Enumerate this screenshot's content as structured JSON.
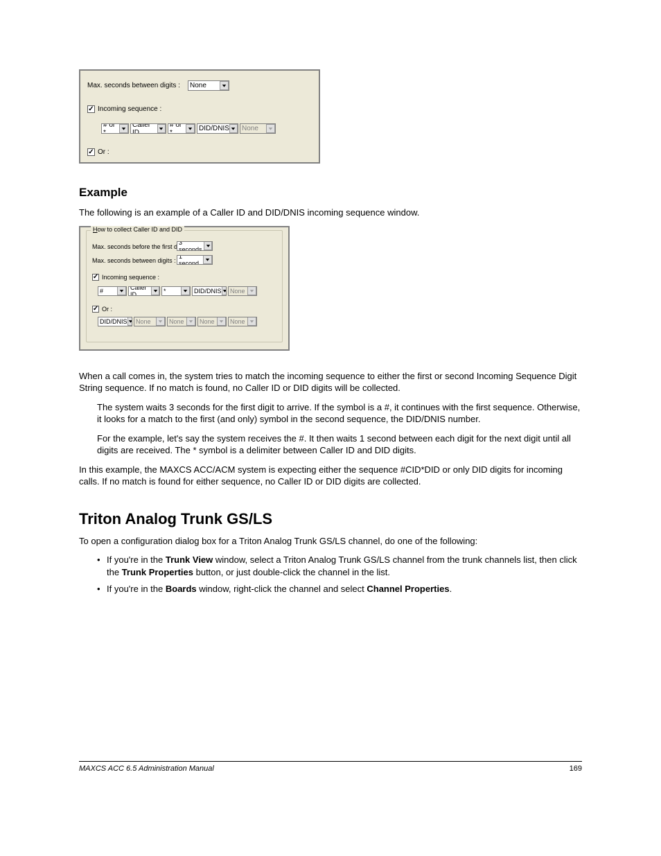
{
  "shot1": {
    "max_between_label": "Max. seconds between digits :",
    "max_between_value": "None",
    "incoming_label": "Incoming sequence :",
    "c1": "# or *",
    "c2": "Caller ID",
    "c3": "# or *",
    "c4": "DID/DNIS",
    "c5": "None",
    "or_label": "Or :"
  },
  "shot2": {
    "legend_pre": "H",
    "legend_rest": "ow to collect Caller ID and DID",
    "max_before_label": "Max. seconds before the first digit :",
    "max_before_value": "3 seconds",
    "max_between_label": "Max. seconds between digits :",
    "max_between_value": "1 second",
    "incoming_label": "Incoming sequence :",
    "r4c1": "#",
    "r4c2": "Caller ID",
    "r4c3": "*",
    "r4c4": "DID/DNIS",
    "r4c5": "None",
    "or_label": "Or :",
    "r6c1": "DID/DNIS",
    "r6c2": "None",
    "r6c3": "None",
    "r6c4": "None",
    "r6c5": "None"
  },
  "doc": {
    "sec_example": "Example",
    "p_intro": "The following is an example of a Caller ID and DID/DNIS incoming sequence window.",
    "p_when": "When a call comes in, the system tries to match the incoming sequence to either the first or second Incoming Sequence Digit String sequence. If no match is found, no Caller ID or DID digits will be collected.",
    "p_wait": "The system waits 3 seconds for the first digit to arrive. If the symbol is a #, it continues with the first sequence. Otherwise, it looks for a match to the first (and only) symbol in the second sequence, the DID/DNIS number.",
    "p_for": "For the example, let's say the system receives the #. It then waits 1 second between each digit for the next digit until all digits are received. The * symbol is a delimiter between Caller ID and DID digits.",
    "p_inthis": "In this example, the MAXCS ACC/ACM system is expecting either the sequence #CID*DID or only DID digits for incoming calls. If no match is found for either sequence, no Caller ID or DID digits are collected.",
    "h1": "Triton Analog Trunk GS/LS",
    "p_open": "To open a configuration dialog box for a Triton Analog Trunk GS/LS channel, do one of the following:",
    "b1a": "If you're in the ",
    "b1b": "Trunk View",
    "b1c": " window, select a Triton Analog Trunk GS/LS channel from the trunk channels list, then click the ",
    "b1d": "Trunk Properties",
    "b1e": " button, or just double-click the channel in the list.",
    "b2a": "If you're in the ",
    "b2b": "Boards",
    "b2c": " window, right-click the channel and select ",
    "b2d": "Channel Properties",
    "b2e": ".",
    "footer_left": "MAXCS ACC 6.5 Administration Manual",
    "footer_right": "169"
  }
}
